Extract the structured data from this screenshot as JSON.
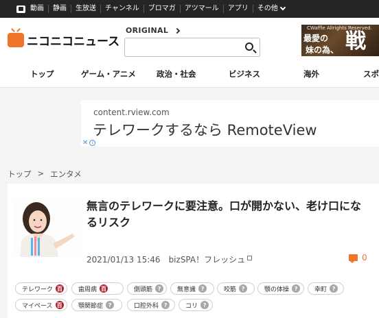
{
  "topnav": {
    "items": [
      "動画",
      "静画",
      "生放送",
      "チャンネル",
      "ブロマガ",
      "アツマール",
      "アプリ"
    ],
    "more": "その他"
  },
  "header": {
    "logo_text": "ニコニコニュース",
    "original_label": "ORIGINAL",
    "search_placeholder": "",
    "banner": {
      "small": "CWaffle Allrights Reserved.",
      "line1": "最愛の",
      "line2": "妹の為、",
      "big": "戦"
    }
  },
  "categories": [
    "トップ",
    "ゲーム・アニメ",
    "政治・社会",
    "ビジネス",
    "海外",
    "スポ"
  ],
  "ad": {
    "url": "content.rview.com",
    "title": "テレワークするなら RemoteView",
    "close": "✕",
    "info": "i"
  },
  "breadcrumb": {
    "home": "トップ",
    "sep": ">",
    "current": "エンタメ"
  },
  "article": {
    "title": "無言のテレワークに要注意。口が開かない、老け口になるリスク",
    "date": "2021/01/13 15:46",
    "source": "bizSPA！フレッシュ",
    "comments": "0"
  },
  "tags": [
    {
      "label": "テレワーク",
      "icon": "百",
      "kind": "red"
    },
    {
      "label": "歯周病",
      "icon": "百",
      "kind": "red"
    },
    {
      "label": "側頭筋",
      "icon": "?",
      "kind": "gray"
    },
    {
      "label": "無意識",
      "icon": "?",
      "kind": "gray"
    },
    {
      "label": "咬筋",
      "icon": "?",
      "kind": "gray"
    },
    {
      "label": "顎の体操",
      "icon": "?",
      "kind": "gray"
    },
    {
      "label": "幸町",
      "icon": "?",
      "kind": "gray"
    },
    {
      "label": "マイペース",
      "icon": "百",
      "kind": "red"
    },
    {
      "label": "顎関節症",
      "icon": "?",
      "kind": "gray"
    },
    {
      "label": "口腔外科",
      "icon": "?",
      "kind": "gray"
    },
    {
      "label": "コリ",
      "icon": "?",
      "kind": "gray"
    }
  ],
  "colors": {
    "accent": "#f0752b",
    "tag_red": "#b11e2c",
    "tag_gray": "#a8a8a8"
  }
}
